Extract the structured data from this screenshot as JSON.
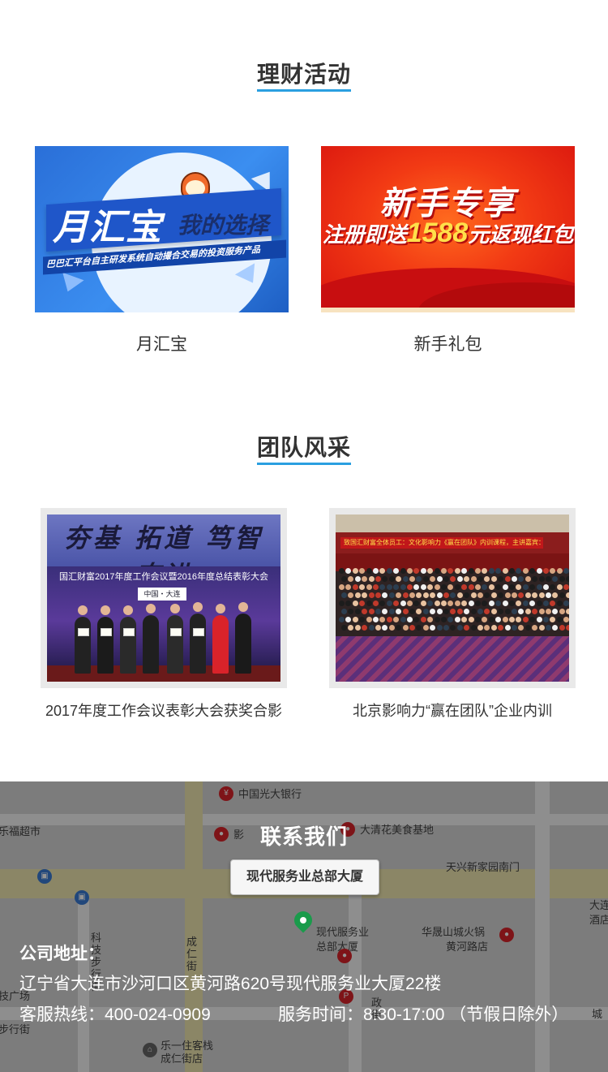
{
  "activities": {
    "title": "理财活动",
    "cards": [
      {
        "caption": "月汇宝",
        "banner_main": "月汇宝",
        "banner_side": "我的选择",
        "banner_sub": "巴巴汇平台自主研发系统自动撮合交易的投资服务产品"
      },
      {
        "caption": "新手礼包",
        "banner_title": "新手专享",
        "banner_line_prefix": "注册即送",
        "banner_line_amount": "1588",
        "banner_line_suffix": "元返现红包"
      }
    ]
  },
  "team": {
    "title": "团队风采",
    "photos": [
      {
        "caption": "2017年度工作会议表彰大会获奖合影",
        "calligraphy": "夯基 拓道 笃智 奋进",
        "event_banner": "国汇财富2017年度工作会议暨2016年度总结表彰大会",
        "city_sign": "中国・大连"
      },
      {
        "caption": "北京影响力“赢在团队”企业内训",
        "sign": "致国汇财富全体员工：文化影响力《赢在团队》内训课程，主讲嘉宾：王诗"
      }
    ]
  },
  "contact": {
    "title": "联系我们",
    "building": "现代服务业总部大厦",
    "address_label": "公司地址：",
    "address": "辽宁省大连市沙河口区黄河路620号现代服务业大厦22楼",
    "hotline_label": "客服热线：",
    "hotline": "400-024-0909",
    "hours_label": "服务时间：",
    "hours": "8:30-17:00 （节假日除外）",
    "map_labels": {
      "bank": "中国光大银行",
      "supermarket": "乐福超市",
      "food_base": "大清花美食基地",
      "tianxing_gate": "天兴新家园南门",
      "hotpot_1": "华晟山城火锅",
      "hotpot_2": "黄河路店",
      "building_1": "现代服务业",
      "building_2": "总部大厦",
      "hotel_1": "乐一住客栈",
      "hotel_2": "成仁街店",
      "street_chengren": "成仁街",
      "street_keji": "科技步行街",
      "plaza": "技广场",
      "walk_street": "步行街",
      "dalian": "大连",
      "jiudian": "酒店",
      "cheng": "城",
      "ying": "影",
      "zheng": "政街"
    }
  },
  "colors": {
    "accent": "#2a9fe0",
    "pin": "#1a9b4b"
  }
}
